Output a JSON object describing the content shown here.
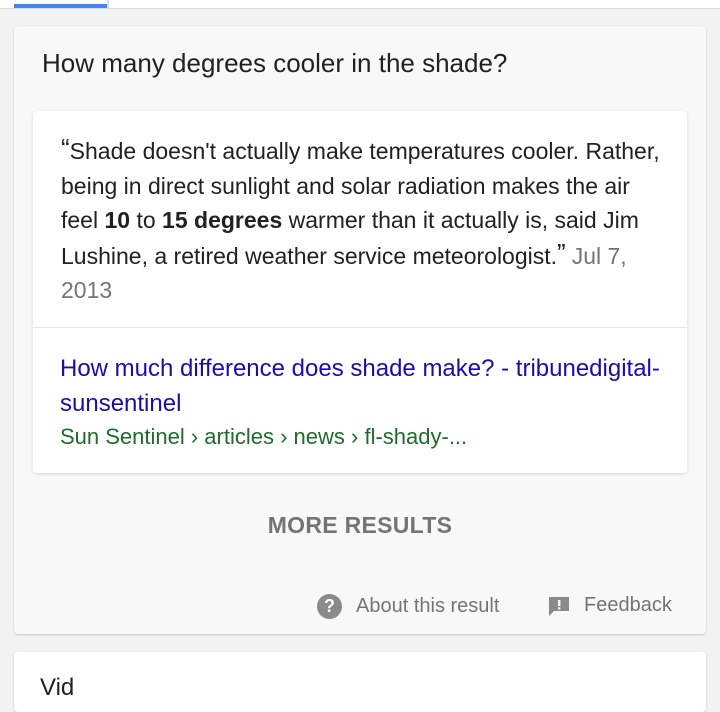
{
  "question": "How many degrees cooler in the shade?",
  "snippet": {
    "open_quote": "“",
    "text_before": "Shade doesn't actually make temperatures cooler. Rather, being in direct sunlight and solar radiation makes the air feel ",
    "bold_1": "10",
    "text_mid": " to ",
    "bold_2": "15 degrees",
    "text_after": " warmer than it actually is, said Jim Lushine, a retired weather service meteorologist.",
    "close_quote": "”",
    "date": "Jul 7, 2013"
  },
  "result": {
    "title": "How much difference does shade make? - tribunedigital-sunsentinel",
    "breadcrumb": "Sun Sentinel › articles › news › fl-shady-..."
  },
  "more_results": "MORE RESULTS",
  "footer": {
    "about_label": "About this result",
    "about_icon": "?",
    "feedback_label": "Feedback"
  },
  "next_card_label": "Vid"
}
